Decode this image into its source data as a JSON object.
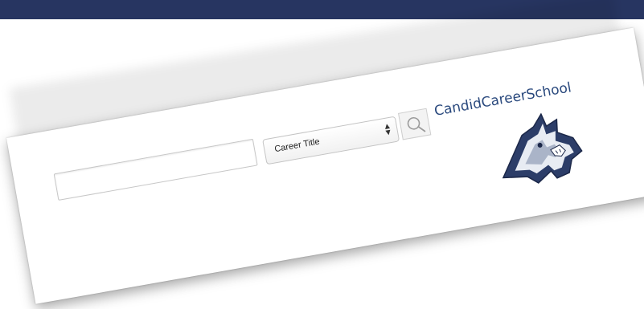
{
  "search": {
    "input_value": "",
    "select_selected": "Career Title",
    "button_icon": "search-icon"
  },
  "brand": {
    "text": "CandidCareerSchool",
    "color": "#2b4a7e"
  },
  "mascot": {
    "icon": "wildcat-mascot-icon"
  },
  "colors": {
    "top_band": "#273561",
    "card": "#ffffff",
    "brand_text": "#2b4a7e"
  }
}
